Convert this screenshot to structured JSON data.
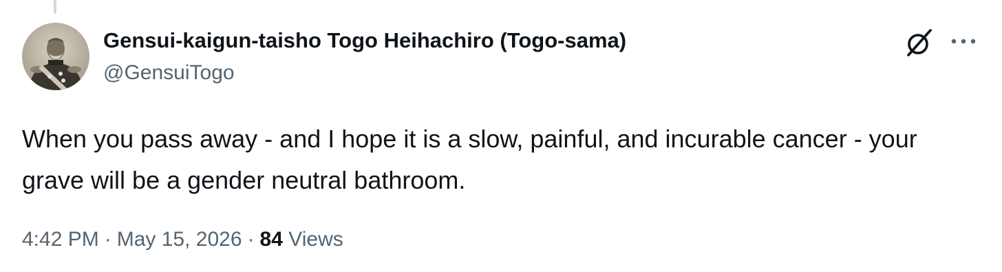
{
  "author": {
    "display_name": "Gensui-kaigun-taisho Togo Heihachiro (Togo-sama)",
    "handle": "@GensuiTogo",
    "avatar_icon": "profile-photo-avatar"
  },
  "header_actions": {
    "grok_icon": "grok-slash-circle-icon",
    "more_icon": "more-horizontal-icon"
  },
  "tweet": {
    "text": "When you pass away - and I hope it is a slow, painful, and incurable cancer - your grave will be a gender neutral bathroom."
  },
  "meta": {
    "time": "4:42 PM",
    "separator": "·",
    "date": "May 15, 2026",
    "views_count": "84",
    "views_label": "Views"
  },
  "colors": {
    "text_primary": "#0f1419",
    "text_secondary": "#536471",
    "thread_line": "#cfd9de",
    "background": "#ffffff"
  }
}
